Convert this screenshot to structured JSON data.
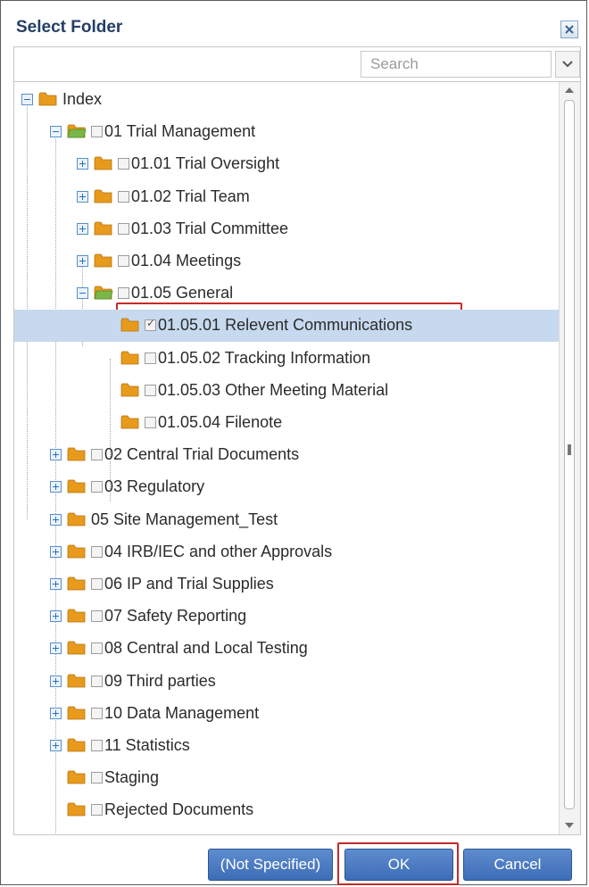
{
  "dialog": {
    "title": "Select Folder"
  },
  "search": {
    "placeholder": "Search"
  },
  "tree": [
    {
      "label": "Index",
      "level": 0,
      "expander": "minus",
      "folder": "orange",
      "checkbox": false
    },
    {
      "label": "01 Trial Management",
      "level": 1,
      "expander": "minus",
      "folder": "green",
      "checkbox": true
    },
    {
      "label": "01.01 Trial Oversight",
      "level": 2,
      "expander": "plus",
      "folder": "orange",
      "checkbox": true
    },
    {
      "label": "01.02 Trial Team",
      "level": 2,
      "expander": "plus",
      "folder": "orange",
      "checkbox": true
    },
    {
      "label": "01.03 Trial Committee",
      "level": 2,
      "expander": "plus",
      "folder": "orange",
      "checkbox": true
    },
    {
      "label": "01.04 Meetings",
      "level": 2,
      "expander": "plus",
      "folder": "orange",
      "checkbox": true
    },
    {
      "label": "01.05 General",
      "level": 2,
      "expander": "minus",
      "folder": "green",
      "checkbox": true
    },
    {
      "label": "01.05.01 Relevent Communications",
      "level": 3,
      "expander": "none",
      "folder": "orange",
      "checkbox": true,
      "checked": true,
      "selected": true
    },
    {
      "label": "01.05.02 Tracking Information",
      "level": 3,
      "expander": "none",
      "folder": "orange",
      "checkbox": true
    },
    {
      "label": "01.05.03 Other Meeting Material",
      "level": 3,
      "expander": "none",
      "folder": "orange",
      "checkbox": true
    },
    {
      "label": "01.05.04 Filenote",
      "level": 3,
      "expander": "none",
      "folder": "orange",
      "checkbox": true
    },
    {
      "label": "02 Central Trial Documents",
      "level": 1,
      "expander": "plus",
      "folder": "orange",
      "checkbox": true
    },
    {
      "label": "03 Regulatory",
      "level": 1,
      "expander": "plus",
      "folder": "orange",
      "checkbox": true
    },
    {
      "label": "05 Site Management_Test",
      "level": 1,
      "expander": "plus",
      "folder": "orange",
      "checkbox": false
    },
    {
      "label": "04 IRB/IEC and other Approvals",
      "level": 1,
      "expander": "plus",
      "folder": "orange",
      "checkbox": true
    },
    {
      "label": "06 IP and Trial Supplies",
      "level": 1,
      "expander": "plus",
      "folder": "orange",
      "checkbox": true
    },
    {
      "label": "07 Safety Reporting",
      "level": 1,
      "expander": "plus",
      "folder": "orange",
      "checkbox": true
    },
    {
      "label": "08 Central and Local Testing",
      "level": 1,
      "expander": "plus",
      "folder": "orange",
      "checkbox": true
    },
    {
      "label": "09 Third parties",
      "level": 1,
      "expander": "plus",
      "folder": "orange",
      "checkbox": true
    },
    {
      "label": "10 Data Management",
      "level": 1,
      "expander": "plus",
      "folder": "orange",
      "checkbox": true
    },
    {
      "label": "11 Statistics",
      "level": 1,
      "expander": "plus",
      "folder": "orange",
      "checkbox": true
    },
    {
      "label": "Staging",
      "level": 1,
      "expander": "none",
      "folder": "orange",
      "checkbox": true
    },
    {
      "label": "Rejected Documents",
      "level": 1,
      "expander": "none",
      "folder": "orange",
      "checkbox": true
    }
  ],
  "footer": {
    "not_specified_label": "(Not Specified)",
    "ok_label": "OK",
    "cancel_label": "Cancel"
  },
  "colors": {
    "selection": "#c6d9ee",
    "button": "#4a7ac3",
    "highlight_outline": "#c42a2a",
    "folder": "#e89a1c",
    "folder_green": "#7ab648"
  },
  "icons": {
    "close": "close-icon",
    "dropdown": "chevron-down-icon",
    "folder": "folder-icon",
    "expander": "tree-toggle-icon"
  }
}
